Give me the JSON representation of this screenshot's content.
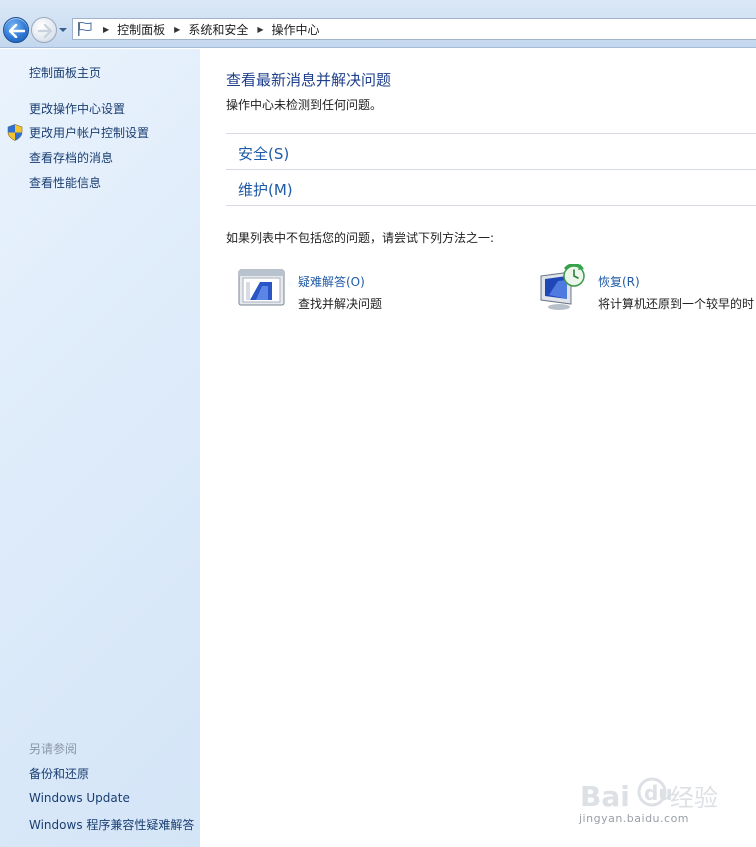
{
  "breadcrumb": [
    "控制面板",
    "系统和安全",
    "操作中心"
  ],
  "left_pane": {
    "home": "控制面板主页",
    "tasks": [
      "更改操作中心设置",
      "更改用户帐户控制设置",
      "查看存档的消息",
      "查看性能信息"
    ],
    "see_also_label": "另请参阅",
    "see_also": [
      "备份和还原",
      "Windows Update",
      "Windows 程序兼容性疑难解答"
    ]
  },
  "main": {
    "title": "查看最新消息并解决问题",
    "subtitle": "操作中心未检测到任何问题。",
    "sections": [
      "安全(S)",
      "维护(M)"
    ],
    "hint": "如果列表中不包括您的问题，请尝试下列方法之一:",
    "tools": [
      {
        "title": "疑难解答(O)",
        "desc": "查找并解决问题",
        "icon": "troubleshoot-icon"
      },
      {
        "title": "恢复(R)",
        "desc": "将计算机还原到一个较早的时",
        "icon": "recovery-icon"
      }
    ]
  },
  "watermark": {
    "text": "jingyan.baidu.com",
    "logo": "Baidu经验"
  },
  "colors": {
    "link": "#1f5aa6",
    "title": "#1e3f8c",
    "pane": "#dfecfa"
  }
}
